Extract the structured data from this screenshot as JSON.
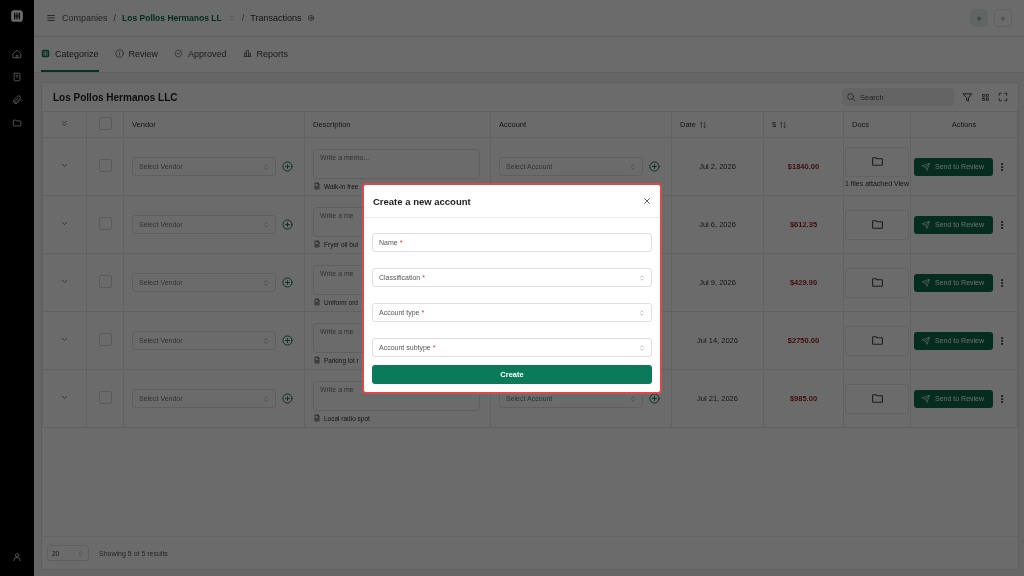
{
  "breadcrumb": [
    {
      "label": "Companies",
      "kind": "link"
    },
    {
      "separator": "/",
      "label": "Los Pollos Hermanos LL",
      "kind": "company"
    },
    {
      "separator": "/",
      "label": "Transactions",
      "kind": "current"
    }
  ],
  "tabs": [
    {
      "label": "Categorize",
      "selected": true
    },
    {
      "label": "Review",
      "selected": false
    },
    {
      "label": "Approved",
      "selected": false
    },
    {
      "label": "Reports",
      "selected": false
    }
  ],
  "card": {
    "title": "Los Pollos Hermanos LLC",
    "search": {
      "placeholder": "Search"
    }
  },
  "table": {
    "all_checked": false,
    "columns": [
      {
        "kind": "expand"
      },
      {
        "kind": "check"
      },
      {
        "label": "Vendor",
        "kind": "text"
      },
      {
        "label": "Description",
        "kind": "text"
      },
      {
        "label": "Account",
        "kind": "text"
      },
      {
        "label": "Date",
        "kind": "sort"
      },
      {
        "label": "$",
        "kind": "sort"
      },
      {
        "label": "Docs",
        "kind": "text"
      },
      {
        "label": "Actions",
        "kind": "center"
      }
    ],
    "rows": [
      {
        "checked": false,
        "vendor": "Select Vendor",
        "memo": "Write a memo...",
        "note": "Walk-in free",
        "account": "Select Account",
        "date": "Jul 2, 2026",
        "amount": "$1840.00",
        "docs_note": "1 files attached View",
        "action": "Send to Review"
      },
      {
        "checked": false,
        "vendor": "Select Vendor",
        "memo": "Write a me",
        "note": "Fryer oil bul",
        "date": "Jul 6, 2026",
        "amount": "$612.35",
        "action": "Send to Review"
      },
      {
        "checked": false,
        "vendor": "Select Vendor",
        "memo": "Write a me",
        "note": "Uniform ord",
        "date": "Jul 9, 2026",
        "amount": "$429.90",
        "action": "Send to Review"
      },
      {
        "checked": false,
        "vendor": "Select Vendor",
        "memo": "Write a me",
        "note": "Parking lot r",
        "date": "Jul 14, 2026",
        "amount": "$2750.00",
        "action": "Send to Review"
      },
      {
        "checked": false,
        "vendor": "Select Vendor",
        "memo": "Write a me",
        "note": "Local radio spot",
        "account": "Select Account",
        "date": "Jul 21, 2026",
        "amount": "$985.00",
        "action": "Send to Review"
      }
    ]
  },
  "footer": {
    "page_size": "20",
    "summary": "Showing 5 of 5 results"
  },
  "modal": {
    "title": "Create a new account",
    "fields": [
      {
        "label": "Name",
        "required_mark": "*",
        "kind": "text"
      },
      {
        "label": "Classification",
        "required_mark": "*",
        "kind": "select"
      },
      {
        "label": "Account type",
        "required_mark": "*",
        "kind": "select"
      },
      {
        "label": "Account subtype",
        "required_mark": "*",
        "kind": "select"
      }
    ],
    "submit": "Create"
  }
}
